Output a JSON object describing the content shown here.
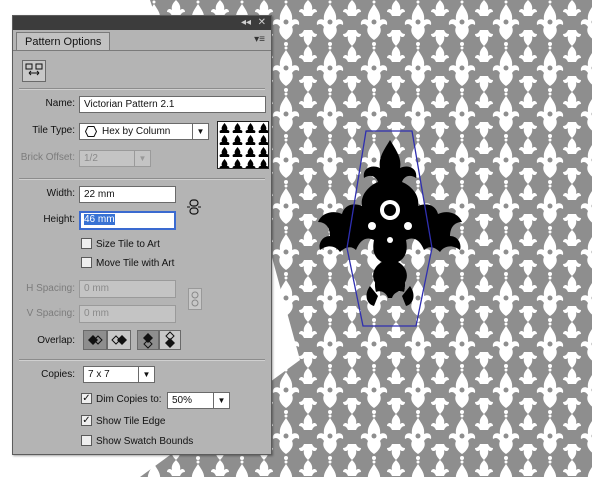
{
  "panel": {
    "title": "Pattern Options",
    "collapse_glyph": "◂◂",
    "close_glyph": "✕",
    "menu_glyph": "▾≡"
  },
  "tile_tool_icon": "pattern-tile-tool-icon",
  "fields": {
    "name": {
      "label": "Name:",
      "value": "Victorian Pattern 2.1"
    },
    "tile_type": {
      "label": "Tile Type:",
      "value": "Hex by Column",
      "icon": "hex-tile-icon"
    },
    "brick_offset": {
      "label": "Brick Offset:",
      "value": "1/2"
    },
    "width": {
      "label": "Width:",
      "value": "22 mm"
    },
    "height": {
      "label": "Height:",
      "value": "46 mm"
    },
    "link_icon": "chain-link-icon",
    "size_tile_to_art": {
      "label": "Size Tile to Art",
      "checked": false
    },
    "move_tile_with_art": {
      "label": "Move Tile with Art",
      "checked": false
    },
    "h_spacing": {
      "label": "H Spacing:",
      "value": "0 mm"
    },
    "v_spacing": {
      "label": "V Spacing:",
      "value": "0 mm"
    },
    "overlap": {
      "label": "Overlap:",
      "buttons": [
        "left-in-front-icon",
        "right-in-front-icon",
        "top-in-front-icon",
        "bottom-in-front-icon"
      ]
    },
    "copies": {
      "label": "Copies:",
      "value": "7 x 7"
    },
    "dim_copies": {
      "label": "Dim Copies to:",
      "checked": true,
      "value": "50%"
    },
    "show_tile_edge": {
      "label": "Show Tile Edge",
      "checked": true
    },
    "show_swatch_bounds": {
      "label": "Show Swatch Bounds",
      "checked": false
    }
  },
  "colors": {
    "pattern_gray": "#8e8e8e",
    "tile_edge_blue": "#2f2fb0",
    "panel_bg": "#b4b4b4",
    "selection_blue": "#3872d4"
  }
}
